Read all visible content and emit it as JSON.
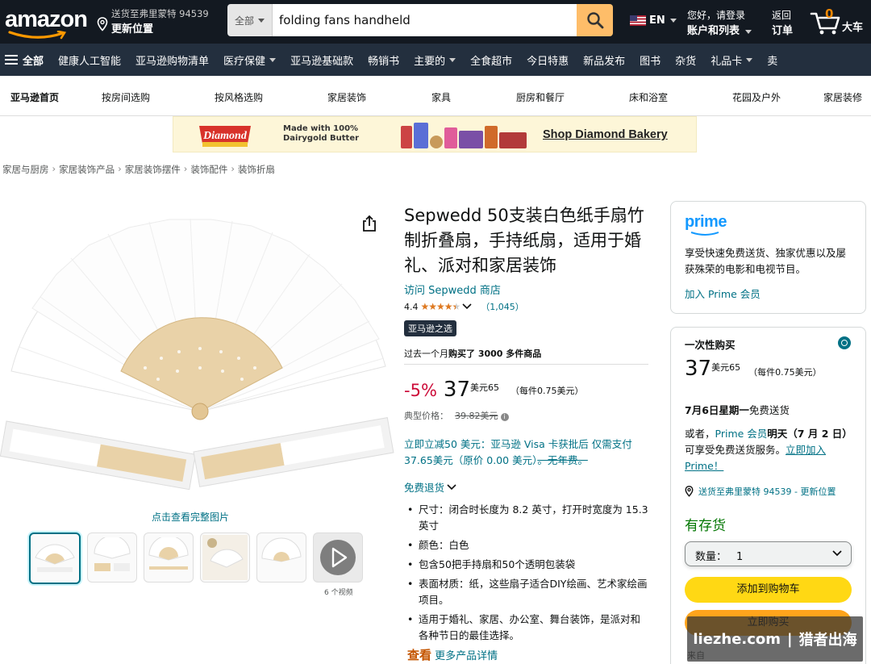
{
  "header": {
    "logo": "amazon",
    "deliver_line1": "送货至弗里蒙特 94539",
    "deliver_line2": "更新位置",
    "search_category": "全部",
    "search_value": "folding fans handheld",
    "lang": "EN",
    "account_line1": "您好，请登录",
    "account_line2": "账户和列表",
    "orders_line1": "返回",
    "orders_line2": "订单",
    "cart_count": "0",
    "cart_label": "大车"
  },
  "nav": {
    "all": "全部",
    "items": [
      {
        "label": "健康人工智能",
        "caret": false
      },
      {
        "label": "亚马逊购物清单",
        "caret": false
      },
      {
        "label": "医疗保健",
        "caret": true
      },
      {
        "label": "亚马逊基础款",
        "caret": false
      },
      {
        "label": "畅销书",
        "caret": false
      },
      {
        "label": "主要的",
        "caret": true
      },
      {
        "label": "全食超市",
        "caret": false
      },
      {
        "label": "今日特惠",
        "caret": false
      },
      {
        "label": "新品发布",
        "caret": false
      },
      {
        "label": "图书",
        "caret": false
      },
      {
        "label": "杂货",
        "caret": false
      },
      {
        "label": "礼品卡",
        "caret": true
      },
      {
        "label": "卖",
        "caret": false
      }
    ]
  },
  "subnav": [
    "亚马逊首页",
    "按房间选购",
    "按风格选购",
    "家居装饰",
    "家具",
    "厨房和餐厅",
    "床和浴室",
    "花园及户外",
    "家居装修"
  ],
  "banner": {
    "brand": "Diamond",
    "made_line1": "Made with 100%",
    "made_line2": "Dairygold Butter",
    "cta": "Shop Diamond Bakery"
  },
  "breadcrumbs": [
    "家居与厨房",
    "家居装饰产品",
    "家居装饰摆件",
    "装饰配件",
    "装饰折扇"
  ],
  "gallery": {
    "see_full": "点击查看完整图片",
    "video_label": "6 个视频"
  },
  "product": {
    "title": "Sepwedd 50支装白色纸手扇竹制折叠扇，手持纸扇，适用于婚礼、派对和家居装饰",
    "store": "访问 Sepwedd 商店",
    "rating": "4.4",
    "stars": 4.4,
    "review_count": "（1,045）",
    "choice": "亚马逊之选",
    "bought_pre": "过去一个月",
    "bought_bold": "购买了 3000 多件商品",
    "discount": "-5%",
    "price_int": "37",
    "price_unit": "美元65",
    "per_unit": "（每件0.75美元）",
    "typical_label": "典型价格：",
    "typical_price": "39.82美元",
    "visa_text": "立即立减50 美元：亚马逊 Visa 卡获批后 仅需支付 37.65美元（原价 0.00 美元）",
    "visa_struck": "。无年费。",
    "returns": "免费退货",
    "bullets": [
      "尺寸：闭合时长度为 8.2 英寸，打开时宽度为 15.3 英寸",
      "颜色：白色",
      "包含50把手持扇和50个透明包装袋",
      "表面材质：纸，这些扇子适合DIY绘画、艺术家绘画项目。",
      "适用于婚礼、家居、办公室、舞台装饰，是派对和各种节日的最佳选择。"
    ],
    "more_bold": "查看",
    "more_text": "更多产品详情"
  },
  "prime_box": {
    "logo": "prime",
    "desc": "享受快速免费送货、独家优惠以及屡获殊荣的电影和电视节目。",
    "join": "加入 Prime 会员"
  },
  "buy_box": {
    "onetime": "一次性购买",
    "price_int": "37",
    "price_unit": "美元65",
    "per_unit": "（每件0.75美元）",
    "delivery_bold": "7月6日星期一",
    "delivery_rest": "免费送货",
    "or_prefix": "或者，",
    "or_link": "Prime 会员",
    "or_bold": "明天（7 月 2 日）",
    "or_rest": "可享受免费送货服务。",
    "or_cta": "立即加入 Prime！",
    "deliver_to": "送货至弗里蒙特 94539 - 更新位置",
    "instock": "有存货",
    "qty_label": "数量：",
    "qty_value": "1",
    "add_cart": "添加到购物车",
    "buy_now": "立即购买",
    "ship_from": "来自"
  },
  "watermark": {
    "left": "liezhe.com",
    "right": "猎者出海"
  },
  "colors": {
    "nav_top": "#131921",
    "nav_main": "#232f3e",
    "search_btn": "#febd69",
    "add_cart": "#ffd814",
    "buy_now": "#ffa41c",
    "link": "#007185",
    "discount": "#cc0c39",
    "instock": "#007600"
  }
}
